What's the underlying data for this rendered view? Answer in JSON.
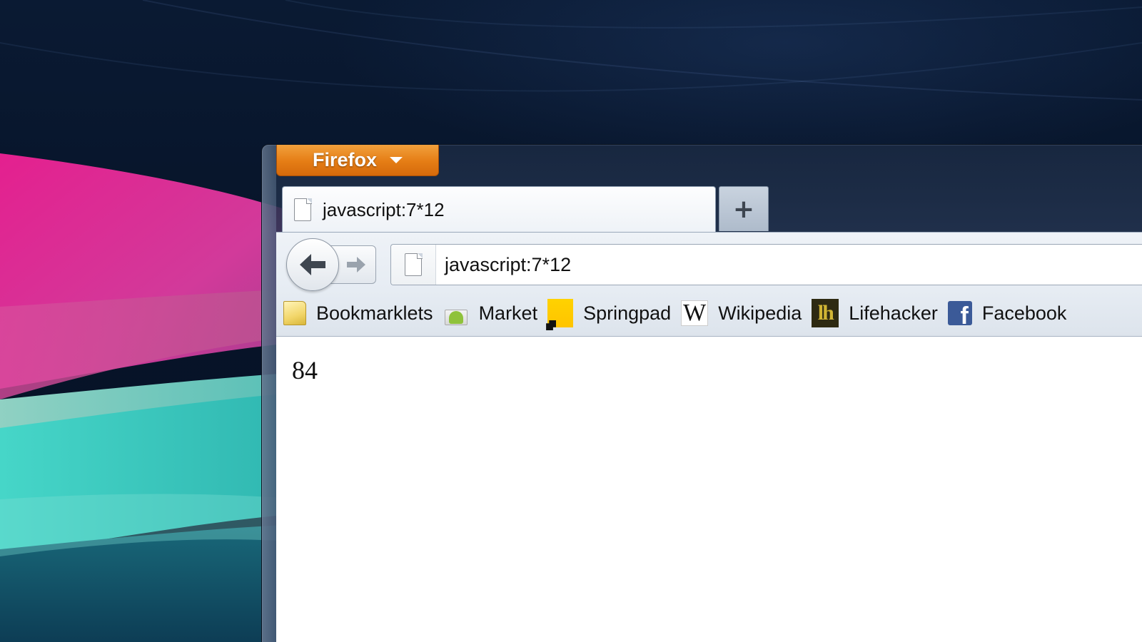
{
  "window": {
    "app_menu_label": "Firefox"
  },
  "tabs": [
    {
      "label": "javascript:7*12",
      "active": true
    }
  ],
  "new_tab_symbol": "+",
  "navigation": {
    "url": "javascript:7*12"
  },
  "bookmarks": [
    {
      "label": "Bookmarklets",
      "icon": "folder-icon"
    },
    {
      "label": "Market",
      "icon": "android-market-icon"
    },
    {
      "label": "Springpad",
      "icon": "springpad-icon"
    },
    {
      "label": "Wikipedia",
      "icon": "wikipedia-icon"
    },
    {
      "label": "Lifehacker",
      "icon": "lifehacker-icon"
    },
    {
      "label": "Facebook",
      "icon": "facebook-icon"
    }
  ],
  "page": {
    "result": "84"
  },
  "icons": {
    "wikipedia_glyph": "W",
    "lifehacker_glyph": "lh",
    "facebook_glyph": "f"
  },
  "colors": {
    "firefox_button": "#e57d15",
    "desktop_background": "#071429",
    "facebook_blue": "#3b5a98",
    "springpad_yellow": "#ffd200"
  }
}
